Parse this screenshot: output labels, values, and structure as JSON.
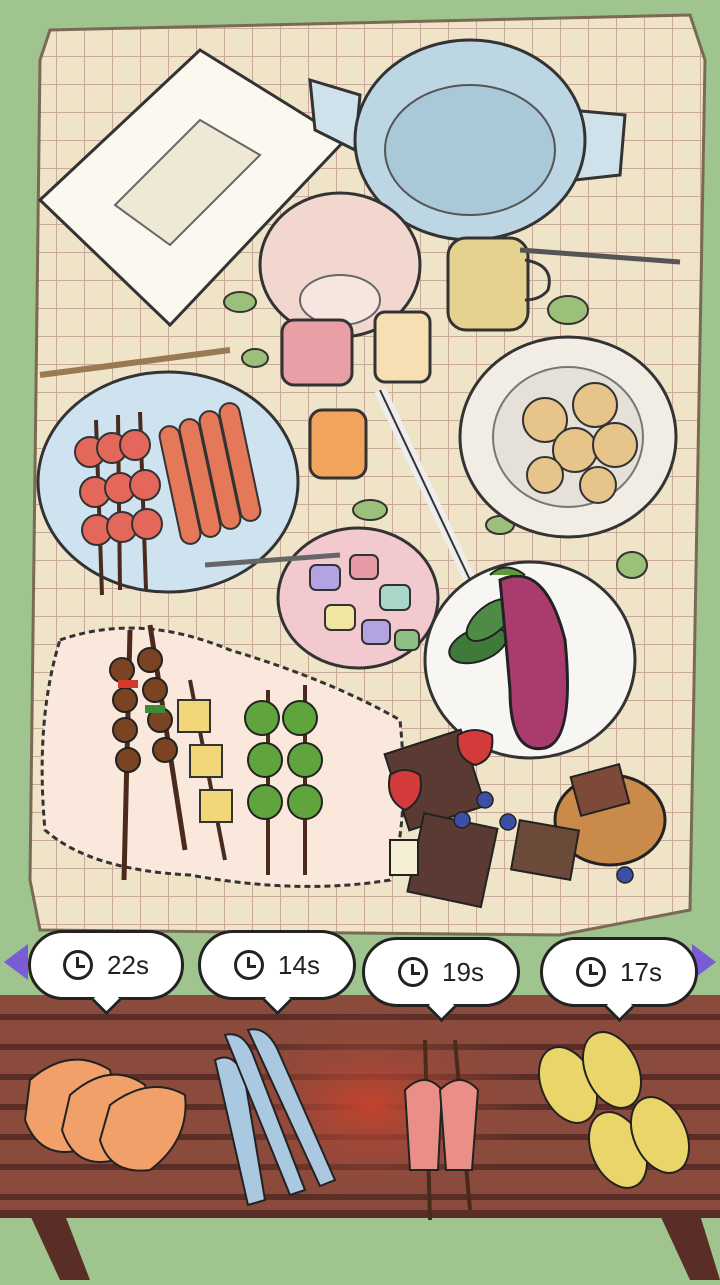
{
  "timers": [
    {
      "label": "22s",
      "item": "shrimp"
    },
    {
      "label": "14s",
      "item": "fish"
    },
    {
      "label": "19s",
      "item": "squid"
    },
    {
      "label": "17s",
      "item": "corn"
    }
  ],
  "colors": {
    "grass": "#9fc48e",
    "cloth": "#efe3c8",
    "cloth_grid": "#c9a99a",
    "grill": "#8a4a3c",
    "grill_dark": "#5a2e26",
    "arrow": "#7a5cd6"
  }
}
